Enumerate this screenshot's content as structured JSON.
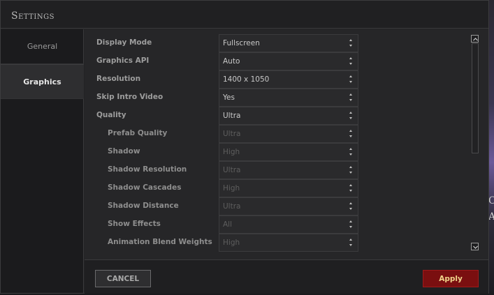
{
  "title": "Settings",
  "sidebar": {
    "tabs": [
      {
        "label": "General",
        "active": false
      },
      {
        "label": "Graphics",
        "active": true
      }
    ]
  },
  "settings": [
    {
      "label": "Display Mode",
      "value": "Fullscreen",
      "sub": false,
      "enabled": true
    },
    {
      "label": "Graphics API",
      "value": "Auto",
      "sub": false,
      "enabled": true
    },
    {
      "label": "Resolution",
      "value": "1400 x 1050",
      "sub": false,
      "enabled": true
    },
    {
      "label": "Skip Intro Video",
      "value": "Yes",
      "sub": false,
      "enabled": true
    },
    {
      "label": "Quality",
      "value": "Ultra",
      "sub": false,
      "enabled": true
    },
    {
      "label": "Prefab Quality",
      "value": "Ultra",
      "sub": true,
      "enabled": false
    },
    {
      "label": "Shadow",
      "value": "High",
      "sub": true,
      "enabled": false
    },
    {
      "label": "Shadow Resolution",
      "value": "Ultra",
      "sub": true,
      "enabled": false
    },
    {
      "label": "Shadow Cascades",
      "value": "High",
      "sub": true,
      "enabled": false
    },
    {
      "label": "Shadow Distance",
      "value": "Ultra",
      "sub": true,
      "enabled": false
    },
    {
      "label": "Show Effects",
      "value": "All",
      "sub": true,
      "enabled": false
    },
    {
      "label": "Animation Blend Weights",
      "value": "High",
      "sub": true,
      "enabled": false
    }
  ],
  "footer": {
    "cancel_label": "CANCEL",
    "apply_label": "Apply"
  },
  "background_glyphs": [
    "C",
    "A"
  ],
  "colors": {
    "apply_bg": "#7a0f10",
    "apply_text": "#f0d48a",
    "panel_bg": "#262628"
  },
  "icons": [
    "scroll-up-icon",
    "scroll-down-icon",
    "dropdown-arrows-icon"
  ]
}
